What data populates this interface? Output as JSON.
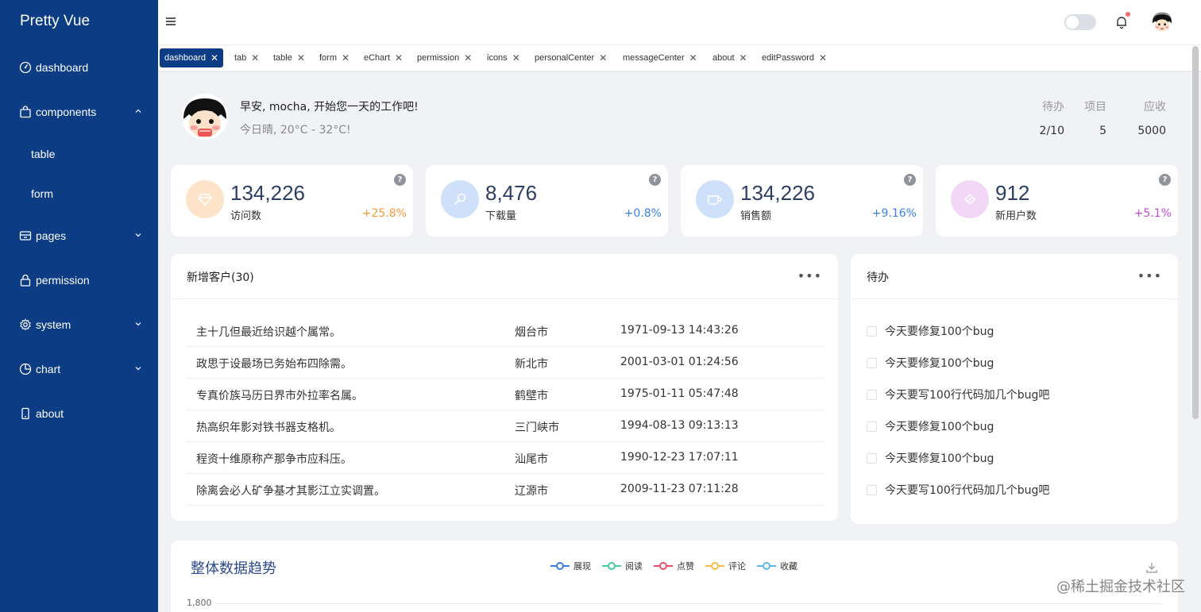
{
  "app": {
    "brand": "Pretty Vue"
  },
  "sidebar": {
    "items": [
      {
        "label": "dashboard",
        "icon": "gauge-icon"
      },
      {
        "label": "components",
        "icon": "bag-icon"
      },
      {
        "label": "table"
      },
      {
        "label": "form"
      },
      {
        "label": "pages",
        "icon": "pages-icon"
      },
      {
        "label": "permission",
        "icon": "lock-icon"
      },
      {
        "label": "system",
        "icon": "gear-icon"
      },
      {
        "label": "chart",
        "icon": "pie-icon"
      },
      {
        "label": "about",
        "icon": "phone-icon"
      }
    ]
  },
  "tabs": [
    "dashboard",
    "tab",
    "table",
    "form",
    "eChart",
    "permission",
    "icons",
    "personalCenter",
    "messageCenter",
    "about",
    "editPassword"
  ],
  "welcome": {
    "greeting": "早安, mocha, 开始您一天的工作吧!",
    "weather": "今日晴, 20°C - 32°C!",
    "stats": [
      {
        "label": "待办",
        "value": "2/10"
      },
      {
        "label": "项目",
        "value": "5"
      },
      {
        "label": "应收",
        "value": "5000"
      }
    ]
  },
  "cards": [
    {
      "value": "134,226",
      "label": "访问数",
      "pct": "+25.8%",
      "color": "#f39c39",
      "bg": "#fde3c8"
    },
    {
      "value": "8,476",
      "label": "下载量",
      "pct": "+0.8%",
      "color": "#3b7ee8",
      "bg": "#cfe0fb"
    },
    {
      "value": "134,226",
      "label": "销售额",
      "pct": "+9.16%",
      "color": "#3b7ee8",
      "bg": "#cfe0fb"
    },
    {
      "value": "912",
      "label": "新用户数",
      "pct": "+5.1%",
      "color": "#c44ad8",
      "bg": "#f2d8f6"
    }
  ],
  "customers": {
    "title": "新增客户(30)",
    "rows": [
      {
        "text": "主十几但最近给识越个属常。",
        "city": "烟台市",
        "time": "1971-09-13 14:43:26"
      },
      {
        "text": "政思于设最场已务始布四除需。",
        "city": "新北市",
        "time": "2001-03-01 01:24:56"
      },
      {
        "text": "专真价族马历日界市外拉率名属。",
        "city": "鹤壁市",
        "time": "1975-01-11 05:47:48"
      },
      {
        "text": "热高织年影对铁书器支格机。",
        "city": "三门峡市",
        "time": "1994-08-13 09:13:13"
      },
      {
        "text": "程资十维原称产那争市应科压。",
        "city": "汕尾市",
        "time": "1990-12-23 17:07:11"
      },
      {
        "text": "除离会必人矿争基才其影江立实调置。",
        "city": "辽源市",
        "time": "2009-11-23 07:11:28"
      }
    ]
  },
  "todos": {
    "title": "待办",
    "items": [
      "今天要修复100个bug",
      "今天要修复100个bug",
      "今天要写100行代码加几个bug吧",
      "今天要修复100个bug",
      "今天要修复100个bug",
      "今天要写100行代码加几个bug吧"
    ]
  },
  "trend": {
    "title": "整体数据趋势",
    "legend": [
      {
        "name": "展现",
        "color": "#3e7ce8"
      },
      {
        "name": "阅读",
        "color": "#3fcfa5"
      },
      {
        "name": "点赞",
        "color": "#f04a6c"
      },
      {
        "name": "评论",
        "color": "#f5b946"
      },
      {
        "name": "收藏",
        "color": "#5ab7f0"
      }
    ],
    "ytick": "1,800"
  },
  "watermark": "@稀土掘金技术社区"
}
